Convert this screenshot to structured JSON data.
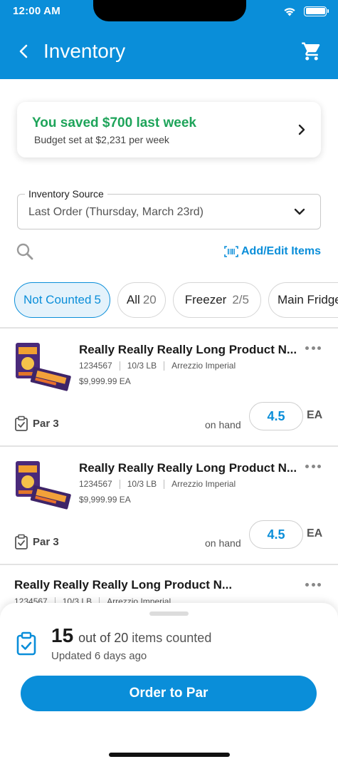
{
  "status_bar": {
    "time": "12:00 AM"
  },
  "header": {
    "title": "Inventory"
  },
  "savings": {
    "title": "You saved $700 last week",
    "subtitle": "Budget set at $2,231 per week"
  },
  "source": {
    "label": "Inventory Source",
    "value": "Last Order (Thursday, March 23rd)"
  },
  "actions": {
    "add_edit_label": "Add/Edit Items"
  },
  "filters": [
    {
      "label": "Not Counted",
      "count": "5",
      "active": true
    },
    {
      "label": "All",
      "count": "20",
      "active": false
    },
    {
      "label": "Freezer",
      "count": "2/5",
      "active": false
    },
    {
      "label": "Main Fridge",
      "count": "",
      "active": false
    }
  ],
  "products": [
    {
      "name": "Really Really Really Long Product N...",
      "sku": "1234567",
      "pack": "10/3 LB",
      "brand": "Arrezzio Imperial",
      "price": "$9,999.99 EA",
      "par": "Par 3",
      "onhand_label": "on hand",
      "qty": "4.5",
      "unit": "EA"
    },
    {
      "name": "Really Really Really Long Product N...",
      "sku": "1234567",
      "pack": "10/3 LB",
      "brand": "Arrezzio Imperial",
      "price": "$9,999.99 EA",
      "par": "Par 3",
      "onhand_label": "on hand",
      "qty": "4.5",
      "unit": "EA"
    },
    {
      "name": "Really Really Really Long Product N...",
      "sku": "1234567",
      "pack": "10/3 LB",
      "brand": "Arrezzio Imperial"
    }
  ],
  "summary": {
    "counted": "15",
    "out_of": "out of",
    "total": "20",
    "suffix": "items counted",
    "updated": "Updated 6 days ago"
  },
  "cta": {
    "order_label": "Order to Par"
  },
  "colors": {
    "brand": "#0a8ed9",
    "success": "#1ea45a"
  }
}
